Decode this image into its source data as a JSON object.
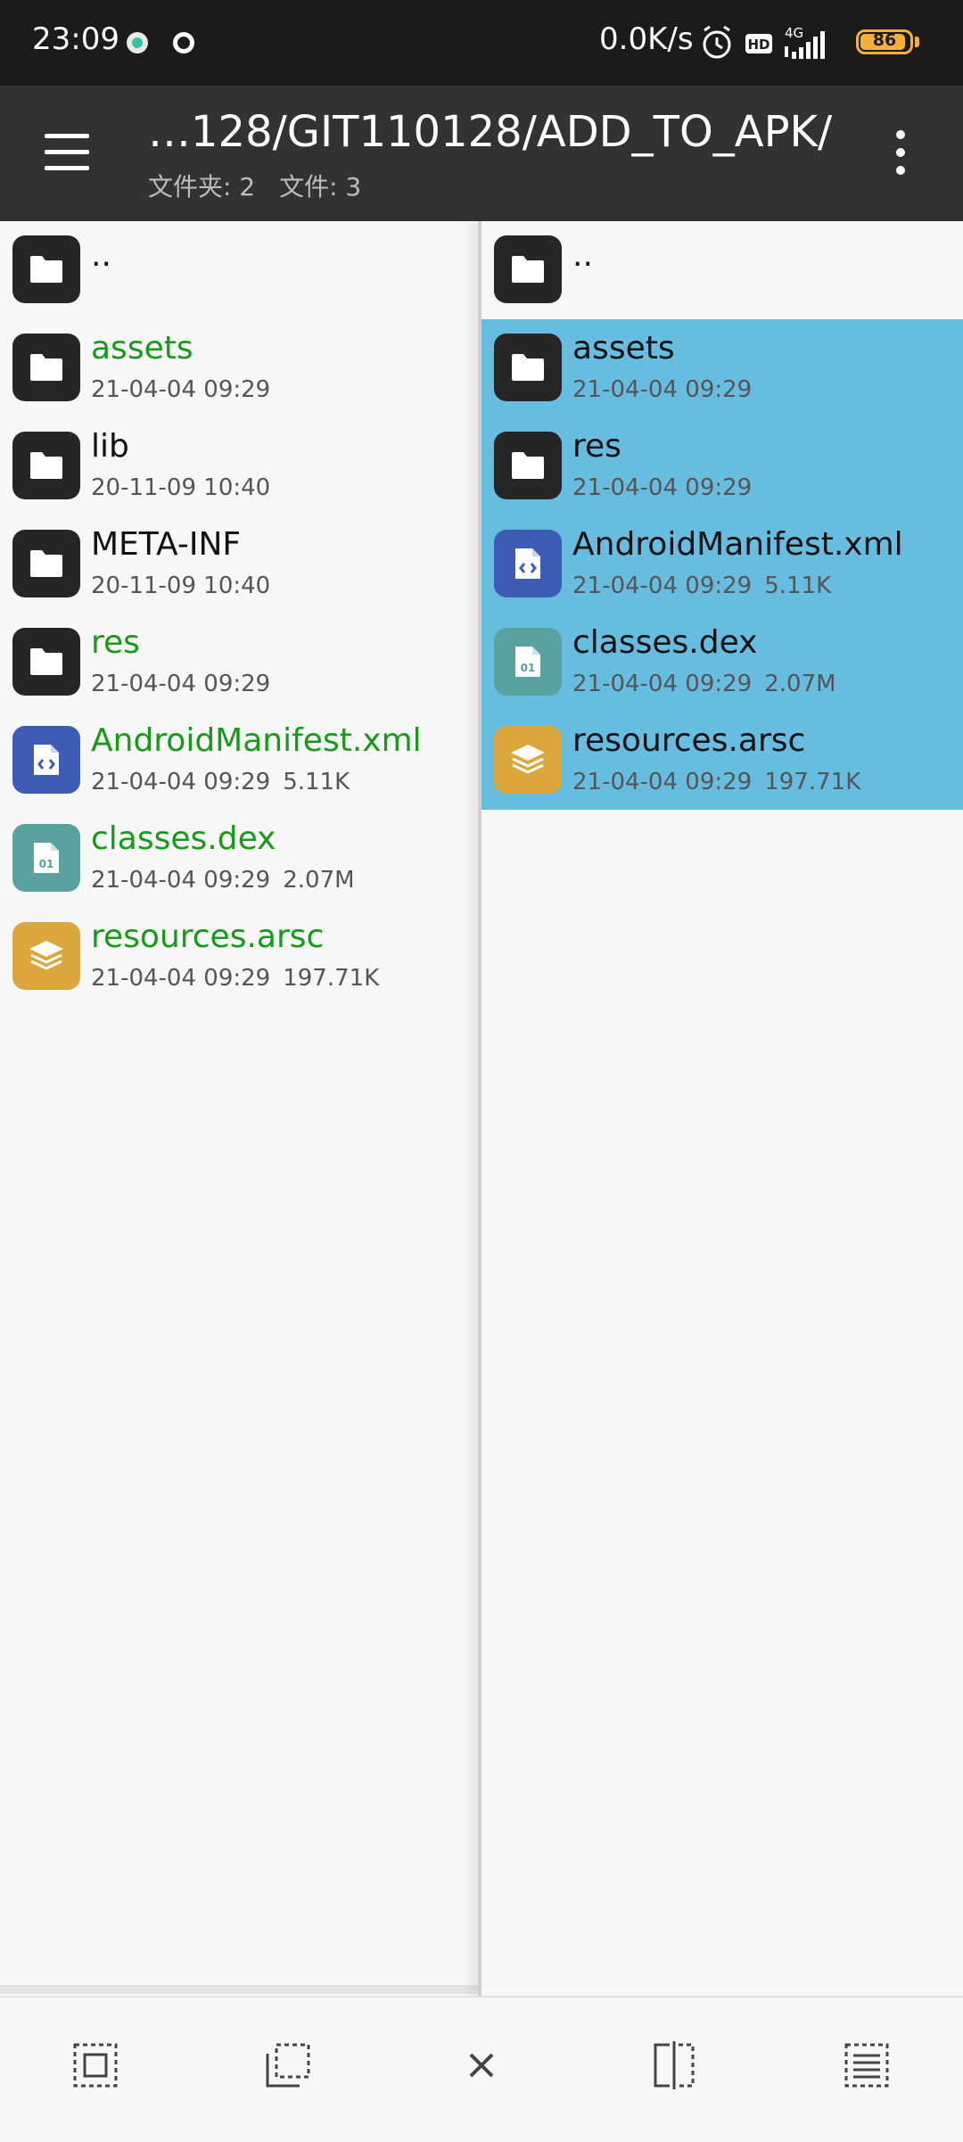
{
  "status_bar": {
    "time": "23:09",
    "net_speed": "0.0K/s",
    "battery": "86",
    "icons": [
      "notification-dot-icon",
      "vpn-icon",
      "alarm-icon",
      "hd-icon",
      "4g-signal-icon",
      "battery-icon"
    ]
  },
  "app_bar": {
    "path": "…128/GIT110128/ADD_TO_APK/",
    "folder_count": "文件夹: 2",
    "file_count": "文件: 3",
    "menu_icon": "hamburger-menu-icon",
    "more_icon": "more-vert-icon"
  },
  "left_pane": {
    "parent": "..",
    "items": [
      {
        "name": "assets",
        "meta": "21-04-04 09:29",
        "size": "",
        "type": "folder",
        "highlight": true
      },
      {
        "name": "lib",
        "meta": "20-11-09 10:40",
        "size": "",
        "type": "folder",
        "highlight": false
      },
      {
        "name": "META-INF",
        "meta": "20-11-09 10:40",
        "size": "",
        "type": "folder",
        "highlight": false
      },
      {
        "name": "res",
        "meta": "21-04-04 09:29",
        "size": "",
        "type": "folder",
        "highlight": true
      },
      {
        "name": "AndroidManifest.xml",
        "meta": "21-04-04 09:29",
        "size": "5.11K",
        "type": "xml",
        "highlight": true
      },
      {
        "name": "classes.dex",
        "meta": "21-04-04 09:29",
        "size": "2.07M",
        "type": "dex",
        "highlight": true
      },
      {
        "name": "resources.arsc",
        "meta": "21-04-04 09:29",
        "size": "197.71K",
        "type": "arsc",
        "highlight": true
      }
    ]
  },
  "right_pane": {
    "parent": "..",
    "items": [
      {
        "name": "assets",
        "meta": "21-04-04 09:29",
        "size": "",
        "type": "folder",
        "selected": true
      },
      {
        "name": "res",
        "meta": "21-04-04 09:29",
        "size": "",
        "type": "folder",
        "selected": true
      },
      {
        "name": "AndroidManifest.xml",
        "meta": "21-04-04 09:29",
        "size": "5.11K",
        "type": "xml",
        "selected": true
      },
      {
        "name": "classes.dex",
        "meta": "21-04-04 09:29",
        "size": "2.07M",
        "type": "dex",
        "selected": true
      },
      {
        "name": "resources.arsc",
        "meta": "21-04-04 09:29",
        "size": "197.71K",
        "type": "arsc",
        "selected": true
      }
    ]
  },
  "bottom_bar": {
    "buttons": [
      "select-all-icon",
      "select-range-icon",
      "close-icon",
      "split-view-icon",
      "list-select-icon"
    ]
  },
  "colors": {
    "status_bar": "#1b1b1b",
    "app_bar": "#323232",
    "highlight_text": "#179a17",
    "selected_row": "#67bde0",
    "folder_icon": "#262626",
    "xml_icon": "#3f5cb5",
    "dex_icon": "#5aa1a1",
    "arsc_icon": "#dba63c",
    "battery": "#f6b03a"
  }
}
